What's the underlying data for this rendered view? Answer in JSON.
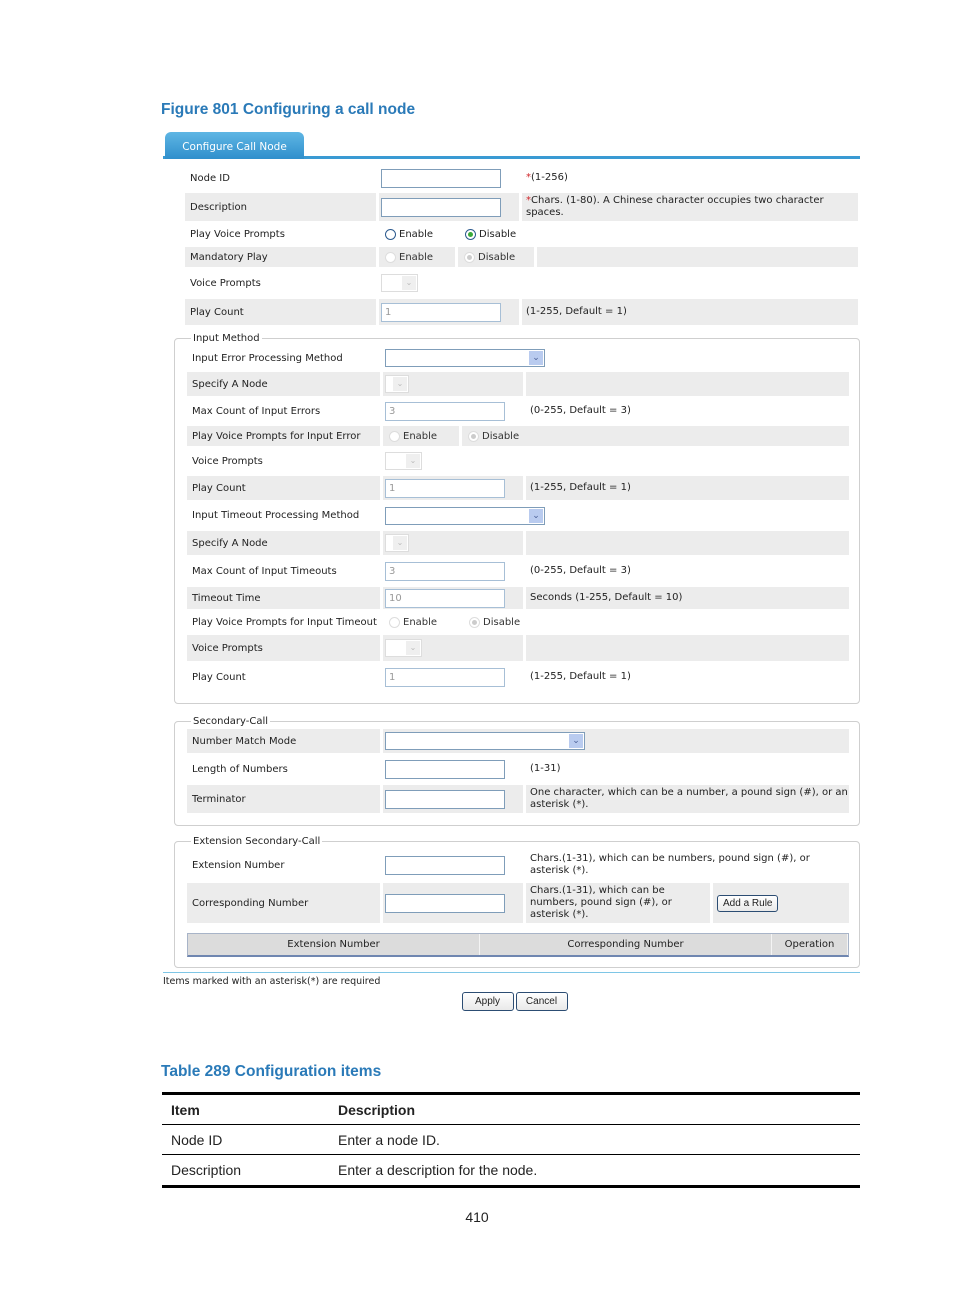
{
  "figure_caption": "Figure 801 Configuring a call node",
  "tab": "Configure Call Node",
  "basic": {
    "node_id": {
      "label": "Node ID",
      "value": "",
      "hint_req": "*",
      "hint": "(1-256)"
    },
    "description": {
      "label": "Description",
      "value": "",
      "hint_req": "*",
      "hint": "Chars. (1-80). A Chinese character occupies two character spaces."
    },
    "play_voice_prompts": {
      "label": "Play Voice Prompts",
      "opt1": "Enable",
      "opt2": "Disable",
      "selected": "Disable"
    },
    "mandatory_play": {
      "label": "Mandatory Play",
      "opt1": "Enable",
      "opt2": "Disable",
      "selected": "Disable"
    },
    "voice_prompts": {
      "label": "Voice Prompts"
    },
    "play_count": {
      "label": "Play Count",
      "value": "1",
      "hint": "(1-255, Default = 1)"
    }
  },
  "input_method": {
    "legend": "Input Method",
    "error_method": {
      "label": "Input Error Processing Method",
      "value": ""
    },
    "specify_node": {
      "label": "Specify A Node"
    },
    "max_errors": {
      "label": "Max Count of Input Errors",
      "value": "3",
      "hint": "(0-255, Default = 3)"
    },
    "prompts_error": {
      "label": "Play Voice Prompts for Input Error",
      "opt1": "Enable",
      "opt2": "Disable",
      "selected": "Disable"
    },
    "voice_prompts": {
      "label": "Voice Prompts"
    },
    "play_count": {
      "label": "Play Count",
      "value": "1",
      "hint": "(1-255, Default = 1)"
    },
    "timeout_method": {
      "label": "Input Timeout Processing Method",
      "value": ""
    },
    "specify_node2": {
      "label": "Specify A Node"
    },
    "max_timeouts": {
      "label": "Max Count of Input Timeouts",
      "value": "3",
      "hint": "(0-255, Default = 3)"
    },
    "timeout_time": {
      "label": "Timeout Time",
      "value": "10",
      "hint": "Seconds (1-255, Default = 10)"
    },
    "prompts_timeout": {
      "label": "Play Voice Prompts for Input Timeout",
      "opt1": "Enable",
      "opt2": "Disable",
      "selected": "Disable"
    },
    "voice_prompts2": {
      "label": "Voice Prompts"
    },
    "play_count2": {
      "label": "Play Count",
      "value": "1",
      "hint": "(1-255, Default = 1)"
    }
  },
  "secondary_call": {
    "legend": "Secondary-Call",
    "match_mode": {
      "label": "Number Match Mode",
      "value": ""
    },
    "length": {
      "label": "Length of Numbers",
      "value": "",
      "hint": "(1-31)"
    },
    "terminator": {
      "label": "Terminator",
      "value": "",
      "hint": "One character, which can be a number, a pound sign (#), or an asterisk (*)."
    }
  },
  "extension": {
    "legend": "Extension Secondary-Call",
    "ext_number": {
      "label": "Extension Number",
      "value": "",
      "hint": "Chars.(1-31), which can be numbers, pound sign (#), or asterisk (*)."
    },
    "corr_number": {
      "label": "Corresponding Number",
      "value": "",
      "hint": "Chars.(1-31), which can be numbers, pound sign (#), or asterisk (*)."
    },
    "add_rule": "Add a Rule",
    "columns": [
      "Extension Number",
      "Corresponding Number",
      "Operation"
    ]
  },
  "footer_note": "Items marked with an asterisk(*) are required",
  "apply": "Apply",
  "cancel": "Cancel",
  "table_caption": "Table 289 Configuration items",
  "doc_table": {
    "headers": [
      "Item",
      "Description"
    ],
    "rows": [
      [
        "Node ID",
        "Enter a node ID."
      ],
      [
        "Description",
        "Enter a description for the node."
      ]
    ]
  },
  "page_number": "410"
}
